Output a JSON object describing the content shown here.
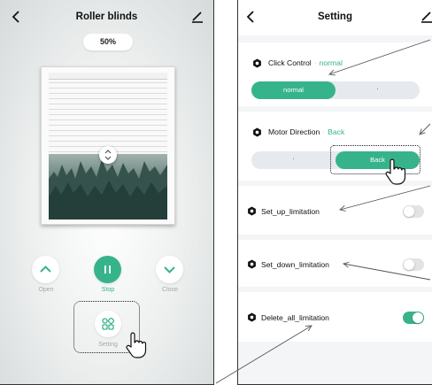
{
  "left_screen": {
    "title": "Roller blinds",
    "position_value": "50%",
    "controls": {
      "open_label": "Open",
      "stop_label": "Stop",
      "close_label": "Close",
      "setting_label": "Setting"
    }
  },
  "right_screen": {
    "title": "Setting",
    "click_control": {
      "label": "Click Control",
      "separator": "·",
      "value": "normal",
      "options": [
        "normal",
        "·"
      ]
    },
    "motor_direction": {
      "label": "Motor Direction",
      "separator": "·",
      "value": "Back",
      "options": [
        "·",
        "Back"
      ]
    },
    "toggles": [
      {
        "label": "Set_up_limitation",
        "on": false
      },
      {
        "label": "Set_down_limitation",
        "on": false
      },
      {
        "label": "Delete_all_limitation",
        "on": true
      }
    ]
  },
  "colors": {
    "accent": "#37b38c",
    "toggle_off": "#e3e3e3",
    "segment_bg": "#e6e9ed",
    "label_gray": "#a6a6a6"
  },
  "icons": {
    "back": "chevron-left-icon",
    "edit": "pencil-line-icon",
    "open": "chevron-up-icon",
    "stop": "pause-icon",
    "close": "chevron-down-icon",
    "setting": "grid-settings-icon",
    "row": "gear-icon",
    "pointer": "hand-pointer-icon"
  }
}
